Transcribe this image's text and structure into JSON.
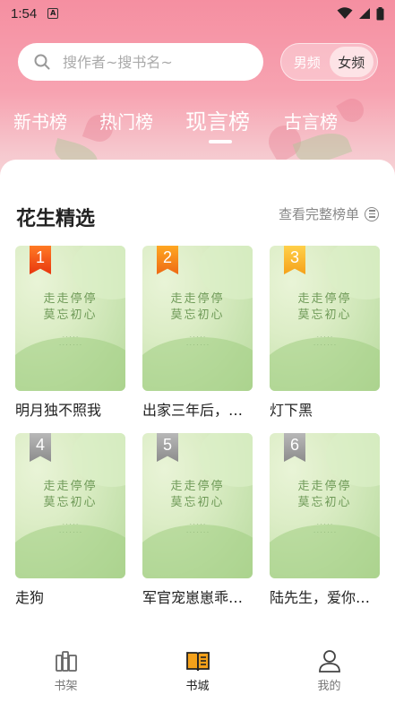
{
  "status_bar": {
    "time": "1:54",
    "notification_glyph": "A"
  },
  "search": {
    "placeholder": "搜作者~搜书名~"
  },
  "gender": {
    "options": [
      "男频",
      "女频"
    ],
    "selected": "女频"
  },
  "tabs": [
    {
      "label": "新书榜",
      "active": false
    },
    {
      "label": "热门榜",
      "active": false
    },
    {
      "label": "现言榜",
      "active": true
    },
    {
      "label": "古言榜",
      "active": false
    }
  ],
  "section": {
    "title": "花生精选",
    "more_label": "查看完整榜单"
  },
  "books": [
    {
      "rank": "1",
      "title": "明月独不照我",
      "cover_line1": "走走停停",
      "cover_line2": "莫忘初心"
    },
    {
      "rank": "2",
      "title": "出家三年后，…",
      "cover_line1": "走走停停",
      "cover_line2": "莫忘初心"
    },
    {
      "rank": "3",
      "title": "灯下黑",
      "cover_line1": "走走停停",
      "cover_line2": "莫忘初心"
    },
    {
      "rank": "4",
      "title": "走狗",
      "cover_line1": "走走停停",
      "cover_line2": "莫忘初心"
    },
    {
      "rank": "5",
      "title": "军官宠崽崽乖…",
      "cover_line1": "走走停停",
      "cover_line2": "莫忘初心"
    },
    {
      "rank": "6",
      "title": "陆先生，爱你…",
      "cover_line1": "走走停停",
      "cover_line2": "莫忘初心"
    }
  ],
  "nav": [
    {
      "label": "书架",
      "icon": "bookshelf-icon",
      "active": false
    },
    {
      "label": "书城",
      "icon": "book-store-icon",
      "active": true
    },
    {
      "label": "我的",
      "icon": "profile-icon",
      "active": false
    }
  ],
  "colors": {
    "accent": "#f58fa1",
    "badge_top": "#e8360e",
    "badge_rest": "#8c8c8c",
    "nav_active": "#f5a11a"
  }
}
